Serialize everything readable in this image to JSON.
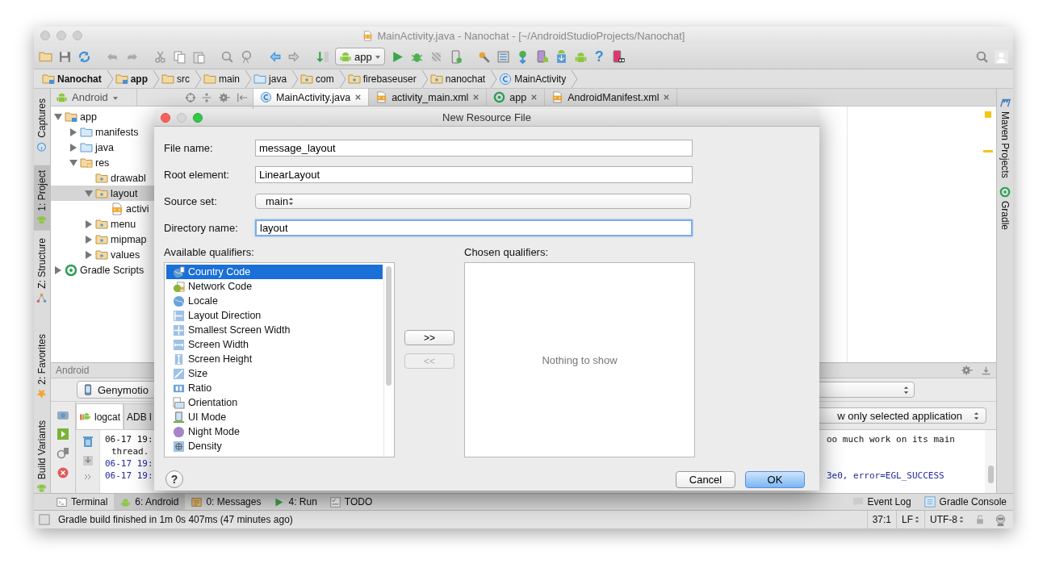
{
  "window": {
    "title": "MainActivity.java - Nanochat - [~/AndroidStudioProjects/Nanochat]"
  },
  "toolbar": {
    "run_config": "app",
    "help": "?"
  },
  "breadcrumbs": [
    {
      "label": "Nanochat",
      "kind": "module"
    },
    {
      "label": "app",
      "kind": "module"
    },
    {
      "label": "src",
      "kind": "folder"
    },
    {
      "label": "main",
      "kind": "folder"
    },
    {
      "label": "java",
      "kind": "source"
    },
    {
      "label": "com",
      "kind": "package"
    },
    {
      "label": "firebaseuser",
      "kind": "package"
    },
    {
      "label": "nanochat",
      "kind": "package"
    },
    {
      "label": "MainActivity",
      "kind": "class"
    }
  ],
  "left_tool_tabs": [
    {
      "label": "Captures",
      "selected": false
    },
    {
      "label": "1: Project",
      "selected": true
    },
    {
      "label": "Z: Structure",
      "selected": false
    },
    {
      "label": "2: Favorites",
      "selected": false
    },
    {
      "label": "Build Variants",
      "selected": false
    }
  ],
  "right_tool_tabs": [
    {
      "label": "Maven Projects",
      "kind": "maven"
    },
    {
      "label": "Gradle",
      "kind": "gradle"
    }
  ],
  "project_panel": {
    "view": "Android",
    "tree": [
      {
        "label": "app",
        "kind": "module",
        "expanded": true,
        "selected": false,
        "children": [
          {
            "label": "manifests",
            "kind": "source",
            "expanded": false,
            "selected": false
          },
          {
            "label": "java",
            "kind": "source",
            "expanded": false,
            "selected": false
          },
          {
            "label": "res",
            "kind": "resroot",
            "expanded": true,
            "selected": false,
            "children": [
              {
                "label": "drawabl",
                "kind": "resdir",
                "selected": false
              },
              {
                "label": "layout",
                "kind": "resdir",
                "expanded": true,
                "selected": true,
                "children": [
                  {
                    "label": "activi",
                    "kind": "xml",
                    "selected": false
                  }
                ]
              },
              {
                "label": "menu",
                "kind": "resdir",
                "expanded": false,
                "selected": false
              },
              {
                "label": "mipmap",
                "kind": "resdir",
                "expanded": false,
                "selected": false
              },
              {
                "label": "values",
                "kind": "resdir",
                "expanded": false,
                "selected": false
              }
            ]
          }
        ]
      },
      {
        "label": "Gradle Scripts",
        "kind": "gradle",
        "expanded": false,
        "selected": false
      }
    ]
  },
  "editor_tabs": [
    {
      "label": "MainActivity.java",
      "kind": "class",
      "selected": true
    },
    {
      "label": "activity_main.xml",
      "kind": "xml",
      "selected": false
    },
    {
      "label": "app",
      "kind": "module",
      "selected": false
    },
    {
      "label": "AndroidManifest.xml",
      "kind": "xml",
      "selected": false
    }
  ],
  "android_panel": {
    "title": "Android",
    "device": "Genymotio",
    "tabs": [
      {
        "label": "logcat",
        "selected": true
      },
      {
        "label": "ADB l",
        "selected": false
      }
    ],
    "filter": "w only selected application",
    "log": [
      {
        "text": "06-17 19:",
        "tail": "oo much work on its main",
        "kind": "info"
      },
      {
        "text": "thread.",
        "kind": "info"
      },
      {
        "text": "06-17 19:",
        "kind": "debug"
      },
      {
        "text": "06-17 19:",
        "tail": "3e0, error=EGL_SUCCESS",
        "kind": "debug"
      }
    ]
  },
  "bottom_tabs": [
    {
      "label": "Terminal",
      "selected": false
    },
    {
      "label": "6: Android",
      "selected": true
    },
    {
      "label": "0: Messages",
      "selected": false
    },
    {
      "label": "4: Run",
      "selected": false
    },
    {
      "label": "TODO",
      "selected": false
    }
  ],
  "bottom_tabs_right": [
    {
      "label": "Event Log"
    },
    {
      "label": "Gradle Console"
    }
  ],
  "status_bar": {
    "message": "Gradle build finished in 1m 0s 407ms (47 minutes ago)",
    "position": "37:1",
    "line_separator": "LF",
    "encoding": "UTF-8"
  },
  "dialog": {
    "title": "New Resource File",
    "fields": [
      {
        "label": "File name:",
        "value": "message_layout",
        "kind": "text",
        "focused": false
      },
      {
        "label": "Root element:",
        "value": "LinearLayout",
        "kind": "text",
        "focused": false
      },
      {
        "label": "Source set:",
        "value": "main",
        "kind": "select",
        "focused": false
      },
      {
        "label": "Directory name:",
        "value": "layout",
        "kind": "text",
        "focused": true
      }
    ],
    "available_label": "Available qualifiers:",
    "available": [
      {
        "label": "Country Code",
        "kind": "country",
        "selected": true
      },
      {
        "label": "Network Code",
        "kind": "network",
        "selected": false
      },
      {
        "label": "Locale",
        "kind": "locale",
        "selected": false
      },
      {
        "label": "Layout Direction",
        "kind": "direction",
        "selected": false
      },
      {
        "label": "Smallest Screen Width",
        "kind": "smallest",
        "selected": false
      },
      {
        "label": "Screen Width",
        "kind": "width",
        "selected": false
      },
      {
        "label": "Screen Height",
        "kind": "height",
        "selected": false
      },
      {
        "label": "Size",
        "kind": "size",
        "selected": false
      },
      {
        "label": "Ratio",
        "kind": "ratio",
        "selected": false
      },
      {
        "label": "Orientation",
        "kind": "orientation",
        "selected": false
      },
      {
        "label": "UI Mode",
        "kind": "uimode",
        "selected": false
      },
      {
        "label": "Night Mode",
        "kind": "night",
        "selected": false
      },
      {
        "label": "Density",
        "kind": "density",
        "selected": false
      }
    ],
    "chosen_label": "Chosen qualifiers:",
    "chosen_empty": "Nothing to show",
    "add_button": {
      "label": ">>",
      "disabled": false
    },
    "remove_button": {
      "label": "<<",
      "disabled": true
    },
    "help": "?",
    "buttons": [
      {
        "label": "Cancel",
        "default": false
      },
      {
        "label": "OK",
        "default": true
      }
    ]
  }
}
